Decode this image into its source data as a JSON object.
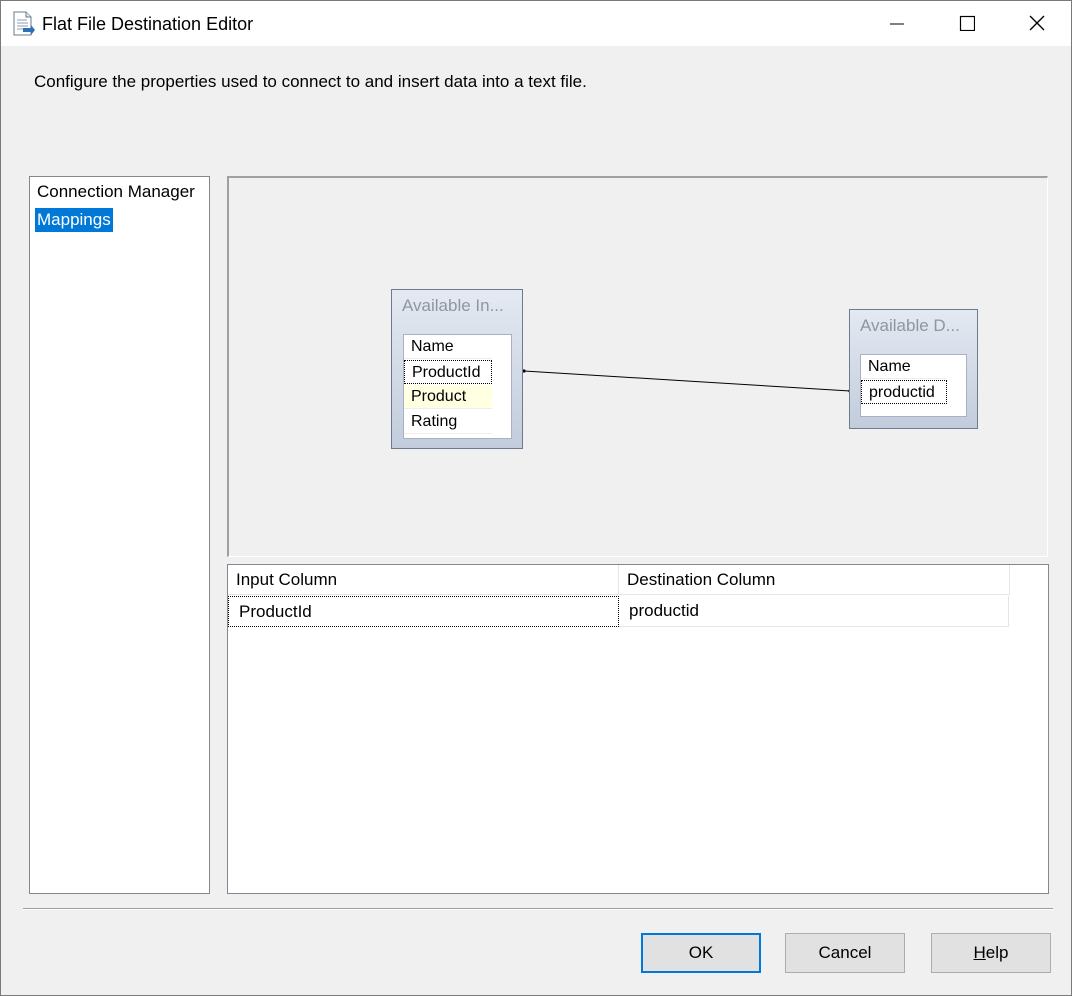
{
  "window": {
    "title": "Flat File Destination Editor",
    "icon": "document-icon"
  },
  "description": "Configure the properties used to connect to and insert data into a text file.",
  "nav": {
    "items": [
      {
        "label": "Connection Manager",
        "selected": false
      },
      {
        "label": "Mappings",
        "selected": true
      }
    ]
  },
  "mapping_designer": {
    "input_table": {
      "title": "Available In...",
      "columns": [
        "Name",
        "ProductId",
        "Product",
        "Rating"
      ],
      "focused": "ProductId",
      "hovered": "Product"
    },
    "destination_table": {
      "title": "Available D...",
      "columns": [
        "Name",
        "productid"
      ],
      "focused": "productid"
    },
    "links": [
      {
        "from": "ProductId",
        "to": "productid"
      }
    ]
  },
  "mapping_grid": {
    "headers": [
      "Input Column",
      "Destination Column"
    ],
    "rows": [
      [
        "ProductId",
        "productid"
      ]
    ]
  },
  "buttons": {
    "ok": "OK",
    "cancel": "Cancel",
    "help_mnemonic": "H",
    "help_rest": "elp"
  },
  "colors": {
    "selection": "#0078d7",
    "hover": "#ffffe1"
  }
}
